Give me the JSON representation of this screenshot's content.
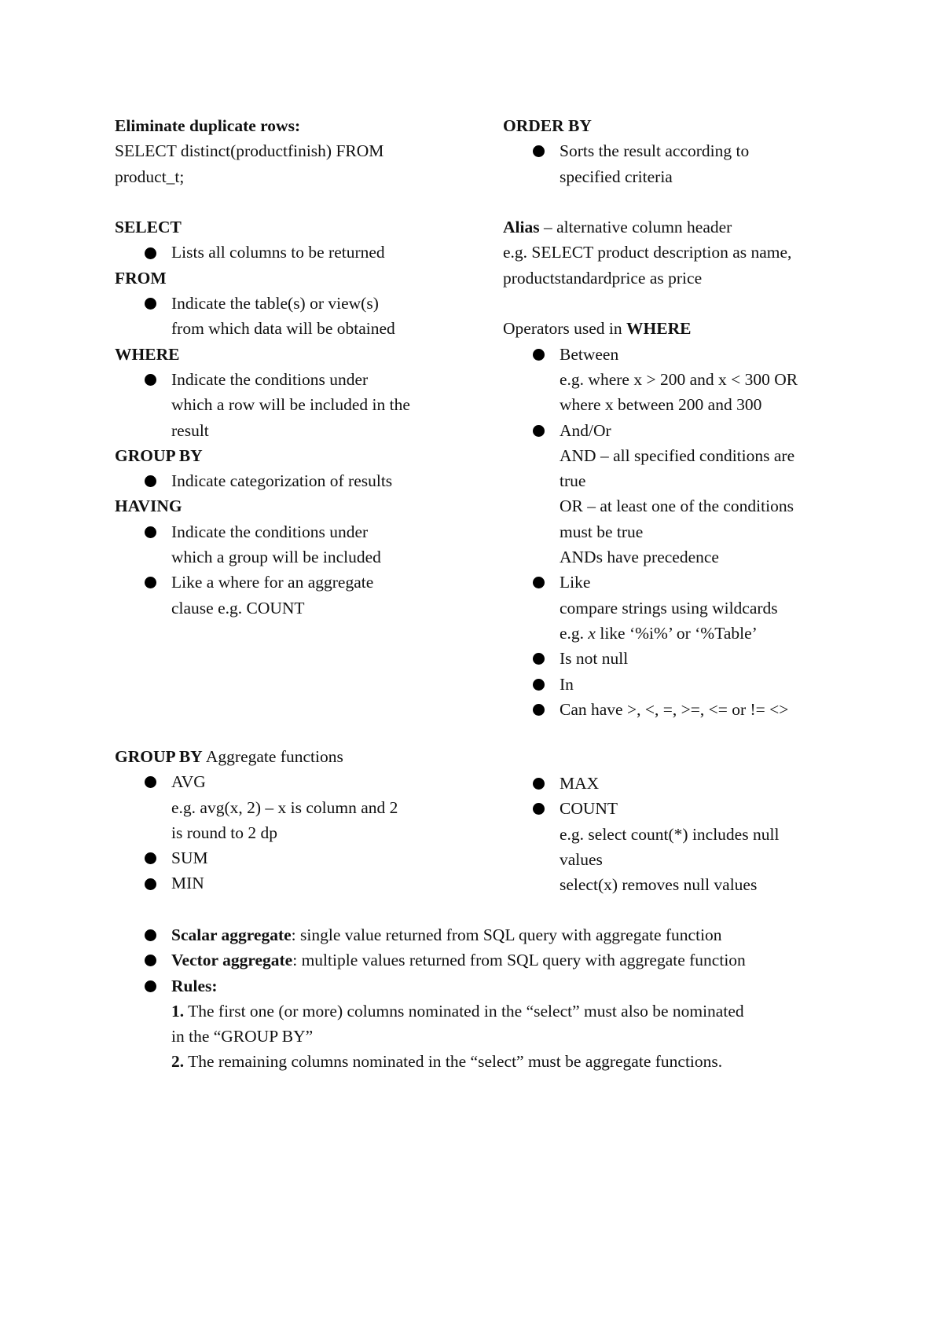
{
  "sections": [
    {
      "id": "left-top",
      "lines": [
        {
          "t": "p",
          "s": [
            {
              "b": 1,
              "x": "Eliminate duplicate rows:"
            }
          ]
        },
        {
          "t": "p",
          "s": [
            {
              "x": "SELECT distinct(productfinish) FROM"
            }
          ]
        },
        {
          "t": "p",
          "s": [
            {
              "x": "product_t;"
            }
          ]
        },
        {
          "t": "blank"
        },
        {
          "t": "p",
          "s": [
            {
              "b": 1,
              "x": "SELECT"
            }
          ]
        },
        {
          "t": "bullet",
          "s": [
            {
              "x": "Lists all columns to be returned"
            }
          ]
        },
        {
          "t": "p",
          "s": [
            {
              "b": 1,
              "x": "FROM"
            }
          ]
        },
        {
          "t": "bullet",
          "s": [
            {
              "x": "Indicate the table(s) or view(s)"
            }
          ]
        },
        {
          "t": "cont",
          "s": [
            {
              "x": "from which data will be obtained"
            }
          ]
        },
        {
          "t": "p",
          "s": [
            {
              "b": 1,
              "x": "WHERE"
            }
          ]
        },
        {
          "t": "bullet",
          "s": [
            {
              "x": "Indicate the conditions under"
            }
          ]
        },
        {
          "t": "cont",
          "s": [
            {
              "x": "which a row will be included in the"
            }
          ]
        },
        {
          "t": "cont",
          "s": [
            {
              "x": "result"
            }
          ]
        },
        {
          "t": "p",
          "s": [
            {
              "b": 1,
              "x": "GROUP BY"
            }
          ]
        },
        {
          "t": "bullet",
          "s": [
            {
              "x": "Indicate categorization of results"
            }
          ]
        },
        {
          "t": "p",
          "s": [
            {
              "b": 1,
              "x": "HAVING"
            }
          ]
        },
        {
          "t": "bullet",
          "s": [
            {
              "x": "Indicate the conditions under"
            }
          ]
        },
        {
          "t": "cont",
          "s": [
            {
              "x": "which a group will be included"
            }
          ]
        },
        {
          "t": "bullet",
          "s": [
            {
              "x": "Like a where for an aggregate"
            }
          ]
        },
        {
          "t": "cont",
          "s": [
            {
              "x": "clause e.g. COUNT"
            }
          ]
        }
      ]
    },
    {
      "id": "right-top",
      "lines": [
        {
          "t": "p",
          "s": [
            {
              "b": 1,
              "x": "ORDER BY"
            }
          ]
        },
        {
          "t": "bullet",
          "s": [
            {
              "x": "Sorts the result according to"
            }
          ]
        },
        {
          "t": "cont",
          "s": [
            {
              "x": "specified criteria"
            }
          ]
        },
        {
          "t": "blank"
        },
        {
          "t": "p",
          "s": [
            {
              "b": 1,
              "x": "Alias"
            },
            {
              "x": " – alternative column header"
            }
          ]
        },
        {
          "t": "p",
          "s": [
            {
              "x": "e.g. SELECT product description as name,"
            }
          ]
        },
        {
          "t": "p",
          "s": [
            {
              "x": "productstandardprice as price"
            }
          ]
        },
        {
          "t": "blank"
        },
        {
          "t": "p",
          "s": [
            {
              "x": "Operators used in "
            },
            {
              "b": 1,
              "x": "WHERE"
            }
          ]
        },
        {
          "t": "bullet",
          "s": [
            {
              "x": "Between"
            }
          ]
        },
        {
          "t": "cont",
          "s": [
            {
              "x": "e.g. where x > 200 and x < 300 OR"
            }
          ]
        },
        {
          "t": "cont",
          "s": [
            {
              "x": "where x between 200 and 300"
            }
          ]
        },
        {
          "t": "bullet",
          "s": [
            {
              "x": "And/Or"
            }
          ]
        },
        {
          "t": "cont",
          "s": [
            {
              "x": "AND – all specified conditions are"
            }
          ]
        },
        {
          "t": "cont",
          "s": [
            {
              "x": "true"
            }
          ]
        },
        {
          "t": "cont",
          "s": [
            {
              "x": "OR – at least one of the conditions"
            }
          ]
        },
        {
          "t": "cont",
          "s": [
            {
              "x": "must be true"
            }
          ]
        },
        {
          "t": "cont",
          "s": [
            {
              "x": "ANDs have precedence"
            }
          ]
        },
        {
          "t": "bullet",
          "s": [
            {
              "x": "Like"
            }
          ]
        },
        {
          "t": "cont",
          "s": [
            {
              "x": "compare strings using wildcards"
            }
          ]
        },
        {
          "t": "cont",
          "s": [
            {
              "x": "e.g. "
            },
            {
              "i": 1,
              "x": "x"
            },
            {
              "x": " like ‘%i%’ or ‘%Table’"
            }
          ]
        },
        {
          "t": "bullet",
          "s": [
            {
              "x": "Is not null"
            }
          ]
        },
        {
          "t": "bullet",
          "s": [
            {
              "x": "In"
            }
          ]
        },
        {
          "t": "bullet",
          "s": [
            {
              "x": "Can have >, <, =, >=, <= or != <>"
            }
          ]
        }
      ]
    },
    {
      "id": "left-aggregate",
      "lines": [
        {
          "t": "p",
          "s": [
            {
              "b": 1,
              "x": "GROUP BY"
            },
            {
              "x": " Aggregate functions"
            }
          ]
        },
        {
          "t": "bullet",
          "s": [
            {
              "x": "AVG"
            }
          ]
        },
        {
          "t": "cont",
          "s": [
            {
              "x": "e.g. avg(x, 2) – x is column and 2"
            }
          ]
        },
        {
          "t": "cont",
          "s": [
            {
              "x": "is round to 2 dp"
            }
          ]
        },
        {
          "t": "bullet",
          "s": [
            {
              "x": "SUM"
            }
          ]
        },
        {
          "t": "bullet",
          "s": [
            {
              "x": "MIN"
            }
          ]
        }
      ]
    },
    {
      "id": "right-aggregate",
      "lines": [
        {
          "t": "bullet",
          "s": [
            {
              "x": "MAX"
            }
          ]
        },
        {
          "t": "bullet",
          "s": [
            {
              "x": "COUNT"
            }
          ]
        },
        {
          "t": "cont",
          "s": [
            {
              "x": "e.g. select count(*) includes null"
            }
          ]
        },
        {
          "t": "cont",
          "s": [
            {
              "x": "values"
            }
          ]
        },
        {
          "t": "cont",
          "s": [
            {
              "x": "select(x) removes null values"
            }
          ]
        }
      ]
    },
    {
      "id": "bottom-rules",
      "lines": [
        {
          "t": "bullet",
          "s": [
            {
              "b": 1,
              "x": "Scalar aggregate"
            },
            {
              "x": ": single value returned from SQL query with aggregate function"
            }
          ]
        },
        {
          "t": "bullet",
          "s": [
            {
              "b": 1,
              "x": "Vector aggregate"
            },
            {
              "x": ": multiple values returned from SQL query with aggregate function"
            }
          ]
        },
        {
          "t": "bullet",
          "s": [
            {
              "b": 1,
              "x": "Rules:"
            }
          ]
        },
        {
          "t": "cont",
          "s": [
            {
              "b": 1,
              "x": "1."
            },
            {
              "x": " The first one (or more) columns nominated in the “select” must also be nominated"
            }
          ]
        },
        {
          "t": "cont",
          "s": [
            {
              "x": "in the “GROUP BY”"
            }
          ]
        },
        {
          "t": "cont",
          "s": [
            {
              "b": 1,
              "x": "2."
            },
            {
              "x": " The remaining columns nominated in the “select” must be aggregate functions."
            }
          ]
        }
      ]
    }
  ]
}
